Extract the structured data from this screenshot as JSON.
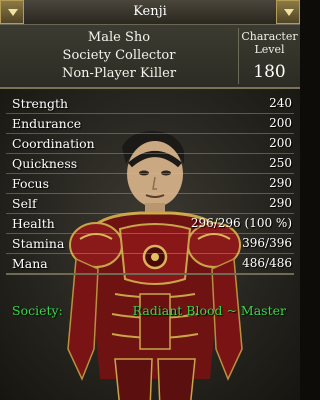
{
  "window": {
    "title": "Kenji"
  },
  "character": {
    "gender_heritage": "Male Sho",
    "title": "Society Collector",
    "pk_status": "Non-Player Killer",
    "level_label": "Character\nLevel",
    "level_label_1": "Character",
    "level_label_2": "Level",
    "level": "180"
  },
  "stats": [
    {
      "name": "Strength",
      "value": "240"
    },
    {
      "name": "Endurance",
      "value": "200"
    },
    {
      "name": "Coordination",
      "value": "200"
    },
    {
      "name": "Quickness",
      "value": "250"
    },
    {
      "name": "Focus",
      "value": "290"
    },
    {
      "name": "Self",
      "value": "290"
    },
    {
      "name": "Health",
      "value": "296/296 (100 %)"
    },
    {
      "name": "Stamina",
      "value": "396/396"
    },
    {
      "name": "Mana",
      "value": "486/486"
    }
  ],
  "society": {
    "label": "Society:",
    "value": "Radiant Blood ~ Master"
  },
  "colors": {
    "society_text": "#39d64a",
    "armor": "#7a1414",
    "gold_trim": "#c9a54a"
  },
  "icons": {
    "title_left": "chevron-down-icon",
    "title_right": "chevron-down-icon"
  }
}
